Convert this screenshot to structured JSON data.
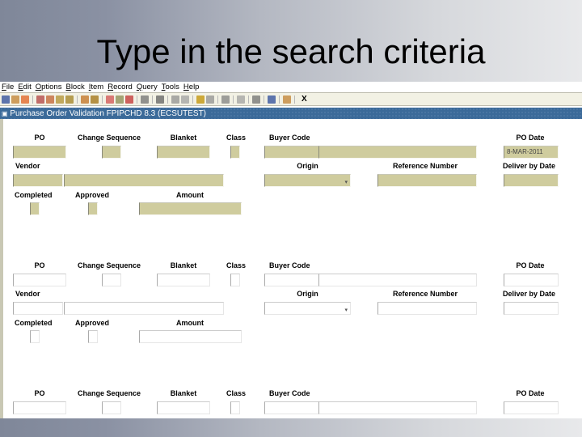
{
  "slide": {
    "title": "Type in the search criteria"
  },
  "menu": [
    "File",
    "Edit",
    "Options",
    "Block",
    "Item",
    "Record",
    "Query",
    "Tools",
    "Help"
  ],
  "toolbar": {
    "icons": [
      "save-icon",
      "rollback-icon",
      "print-report-icon",
      "sep",
      "prev-block-icon",
      "next-block-icon",
      "prev-record-icon",
      "next-record-icon",
      "sep",
      "insert-record-icon",
      "remove-record-icon",
      "sep",
      "enter-query-icon",
      "execute-query-icon",
      "cancel-query-icon",
      "sep",
      "attachment-icon",
      "sep",
      "print-icon",
      "sep",
      "item-prop-icon",
      "help-item-icon",
      "sep",
      "export-icon",
      "import-icon",
      "sep",
      "options-icon",
      "sep",
      "related-icon",
      "sep",
      "notify-icon",
      "sep",
      "online-help-icon",
      "sep",
      "dynamic-help-icon",
      "sep"
    ],
    "exit_label": "X"
  },
  "window": {
    "title": "Purchase Order Validation  FPIPCHD  8.3  (ECSUTEST)"
  },
  "labels": {
    "po": "PO",
    "change_sequence": "Change Sequence",
    "blanket": "Blanket",
    "class": "Class",
    "buyer_code": "Buyer Code",
    "po_date": "PO Date",
    "vendor": "Vendor",
    "origin": "Origin",
    "reference_number": "Reference Number",
    "deliver_by_date": "Deliver by Date",
    "completed": "Completed",
    "approved": "Approved",
    "amount": "Amount"
  },
  "records": [
    {
      "po": "",
      "change_sequence": "",
      "blanket": "",
      "class": "",
      "buyer_code": "",
      "buyer_name": "",
      "po_date": "8-MAR-2011",
      "vendor_id": "",
      "vendor_name": "",
      "origin": "",
      "reference_number": "",
      "deliver_by_date": "",
      "completed": "",
      "approved": "",
      "amount": "",
      "active": true
    },
    {
      "po": "",
      "change_sequence": "",
      "blanket": "",
      "class": "",
      "buyer_code": "",
      "buyer_name": "",
      "po_date": "",
      "vendor_id": "",
      "vendor_name": "",
      "origin": "",
      "reference_number": "",
      "deliver_by_date": "",
      "completed": "",
      "approved": "",
      "amount": "",
      "active": false
    },
    {
      "po": "",
      "change_sequence": "",
      "blanket": "",
      "class": "",
      "buyer_code": "",
      "buyer_name": "",
      "po_date": "",
      "active": false
    }
  ]
}
